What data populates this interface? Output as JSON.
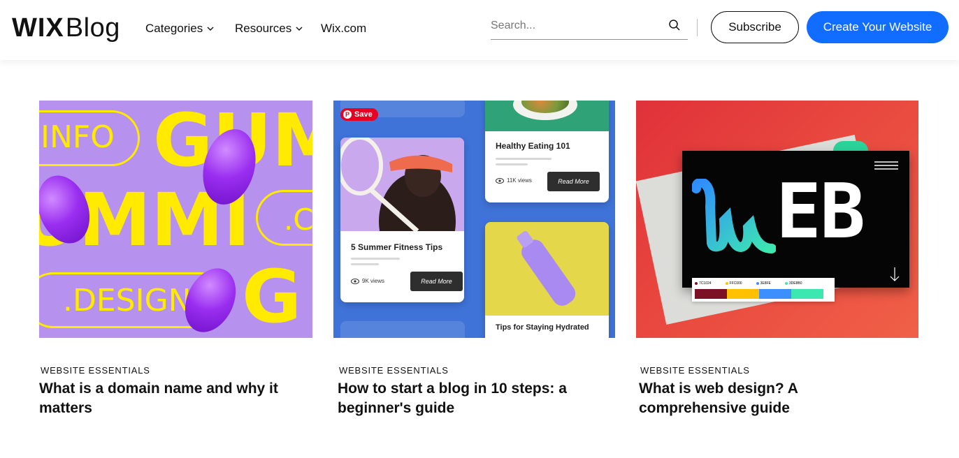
{
  "header": {
    "logo_wix": "WIX",
    "logo_blog": "Blog",
    "nav": [
      {
        "label": "Categories"
      },
      {
        "label": "Resources"
      },
      {
        "label": "Wix.com"
      }
    ],
    "search": {
      "placeholder": "Search...",
      "value": ""
    },
    "subscribe_label": "Subscribe",
    "create_label": "Create Your Website",
    "accent_color": "#116dff"
  },
  "cards": [
    {
      "category": "WEBSITE ESSENTIALS",
      "title": "What is a domain name and why it matters",
      "art": {
        "words": [
          "INFO",
          "GUM",
          "UMMI",
          ".C",
          ".DESIGN",
          "G"
        ]
      }
    },
    {
      "category": "WEBSITE ESSENTIALS",
      "title": "How to start a blog in 10 steps: a beginner's guide",
      "art": {
        "save_label": "Save",
        "tiles": [
          {
            "title": "5 Summer Fitness Tips",
            "views": "9K views",
            "button": "Read More"
          },
          {
            "title": "Healthy Eating 101",
            "views": "11K views",
            "button": "Read More"
          },
          {
            "title": "Tips for Staying Hydrated"
          }
        ]
      }
    },
    {
      "category": "WEBSITE ESSENTIALS",
      "title": "What is web design? A comprehensive guide",
      "art": {
        "word": "EB",
        "swatches": [
          {
            "label": "7C1024",
            "color": "#7c1024"
          },
          {
            "label": "FFC000",
            "color": "#ffc000"
          },
          {
            "label": "3E8FE",
            "color": "#3e8ffe"
          },
          {
            "label": "3DE8B0",
            "color": "#3de8b0"
          }
        ]
      }
    }
  ]
}
